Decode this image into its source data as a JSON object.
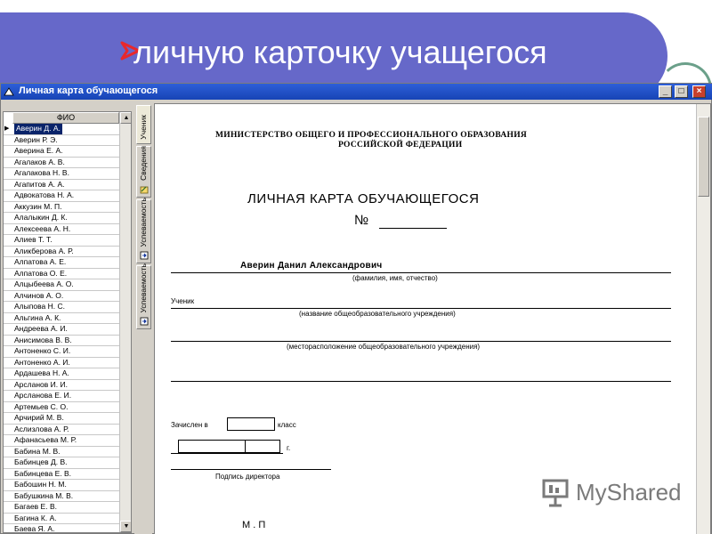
{
  "slide": {
    "title": "личную карточку учащегося"
  },
  "window": {
    "title": "Личная карта обучающегося",
    "controls": {
      "minimize": "_",
      "maximize": "□",
      "close": "×"
    }
  },
  "student_list": {
    "column_header": "ФИО",
    "selected_index": 0,
    "students": [
      "Аверин Д. А.",
      "Аверин Р. Э.",
      "Аверина Е. А.",
      "Агалаков А. В.",
      "Агалакова Н. В.",
      "Агапитов А. А.",
      "Адвокатова Н. А.",
      "Аккузин М. П.",
      "Алалыкин Д. К.",
      "Алексеева А. Н.",
      "Алиев Т. Т.",
      "Аликберова А. Р.",
      "Алпатова А. Е.",
      "Алпатова О. Е.",
      "Алцыбеева А. О.",
      "Алчинов А. О.",
      "Алыпова Н. С.",
      "Альгина А. К.",
      "Андреева А. И.",
      "Анисимова В. В.",
      "Антоненко С. И.",
      "Антоненко А. И.",
      "Ардашева Н. А.",
      "Арсланов И. И.",
      "Арсланова Е. И.",
      "Артемьев С. О.",
      "Арчирий М. В.",
      "Аслизлова А. Р.",
      "Афанасьева М. Р.",
      "Бабина М. В.",
      "Бабинцев Д. В.",
      "Бабинцева Е. В.",
      "Бабошин Н. М.",
      "Бабушкина М. В.",
      "Багаев Е. В.",
      "Багина К. А.",
      "Баева Я. А."
    ]
  },
  "tabs": [
    {
      "label": "Ученик",
      "active": true
    },
    {
      "label": "Сведения",
      "active": false
    },
    {
      "label": "Успеваемость",
      "active": false
    },
    {
      "label": "Успеваемость",
      "active": false
    }
  ],
  "document": {
    "ministry_line1": "МИНИСТЕРСТВО ОБЩЕГО И ПРОФЕССИОНАЛЬНОГО ОБРАЗОВАНИЯ",
    "ministry_line2": "РОССИЙСКОЙ ФЕДЕРАЦИИ",
    "title": "ЛИЧНАЯ КАРТА ОБУЧАЮЩЕГОСЯ",
    "number_label": "№",
    "student_name": "Аверин Данил Александрович",
    "name_caption": "(фамилия, имя, отчество)",
    "student_label": "Ученик",
    "school_caption": "(название общеобразовательного учреждения)",
    "location_caption": "(месторасположение общеобразовательного учреждения)",
    "enrolled_label": "Зачислен в",
    "class_label": "класс",
    "year_suffix": "г.",
    "signature_caption": "Подпись директора",
    "stamp_label": "М . П"
  },
  "watermark": {
    "text": "MyShared"
  }
}
